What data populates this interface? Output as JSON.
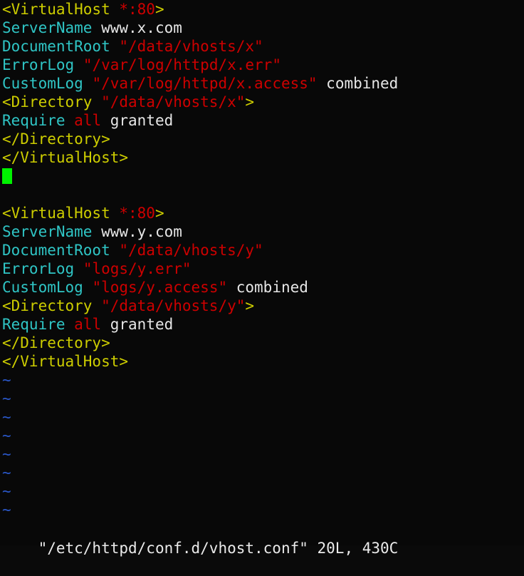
{
  "window": {
    "app": "vim",
    "background_color": "#080808",
    "cursor_color": "#00f200"
  },
  "palette": {
    "tag": "#cdcd00",
    "directive": "#2fc5c5",
    "string": "#cd0000",
    "plain": "#e6e6e6",
    "tilde": "#2a57c8",
    "status": "#eaeaea"
  },
  "editor": {
    "lines": [
      {
        "id": 1,
        "tokens": [
          {
            "t": "<VirtualHost ",
            "c": "tag"
          },
          {
            "t": "*:80",
            "c": "string"
          },
          {
            "t": ">",
            "c": "tag"
          }
        ]
      },
      {
        "id": 2,
        "tokens": [
          {
            "t": "ServerName",
            "c": "directive"
          },
          {
            "t": " www.x.com",
            "c": "plain"
          }
        ]
      },
      {
        "id": 3,
        "tokens": [
          {
            "t": "DocumentRoot",
            "c": "directive"
          },
          {
            "t": " ",
            "c": "plain"
          },
          {
            "t": "\"/data/vhosts/x\"",
            "c": "string"
          }
        ]
      },
      {
        "id": 4,
        "tokens": [
          {
            "t": "ErrorLog",
            "c": "directive"
          },
          {
            "t": " ",
            "c": "plain"
          },
          {
            "t": "\"/var/log/httpd/x.err\"",
            "c": "string"
          }
        ]
      },
      {
        "id": 5,
        "tokens": [
          {
            "t": "CustomLog",
            "c": "directive"
          },
          {
            "t": " ",
            "c": "plain"
          },
          {
            "t": "\"/var/log/httpd/x.access\"",
            "c": "string"
          },
          {
            "t": " combined",
            "c": "plain"
          }
        ]
      },
      {
        "id": 6,
        "tokens": [
          {
            "t": "<Directory ",
            "c": "tag"
          },
          {
            "t": "\"/data/vhosts/x\"",
            "c": "string"
          },
          {
            "t": ">",
            "c": "tag"
          }
        ]
      },
      {
        "id": 7,
        "tokens": [
          {
            "t": "Require",
            "c": "directive"
          },
          {
            "t": " ",
            "c": "plain"
          },
          {
            "t": "all",
            "c": "string"
          },
          {
            "t": " granted",
            "c": "plain"
          }
        ]
      },
      {
        "id": 8,
        "tokens": [
          {
            "t": "</Directory>",
            "c": "tag"
          }
        ]
      },
      {
        "id": 9,
        "tokens": [
          {
            "t": "</VirtualHost>",
            "c": "tag"
          }
        ]
      },
      {
        "id": 10,
        "tokens": [],
        "cursor": true
      },
      {
        "id": 11,
        "tokens": []
      },
      {
        "id": 12,
        "tokens": [
          {
            "t": "<VirtualHost ",
            "c": "tag"
          },
          {
            "t": "*:80",
            "c": "string"
          },
          {
            "t": ">",
            "c": "tag"
          }
        ]
      },
      {
        "id": 13,
        "tokens": [
          {
            "t": "ServerName",
            "c": "directive"
          },
          {
            "t": " www.y.com",
            "c": "plain"
          }
        ]
      },
      {
        "id": 14,
        "tokens": [
          {
            "t": "DocumentRoot",
            "c": "directive"
          },
          {
            "t": " ",
            "c": "plain"
          },
          {
            "t": "\"/data/vhosts/y\"",
            "c": "string"
          }
        ]
      },
      {
        "id": 15,
        "tokens": [
          {
            "t": "ErrorLog",
            "c": "directive"
          },
          {
            "t": " ",
            "c": "plain"
          },
          {
            "t": "\"logs/y.err\"",
            "c": "string"
          }
        ]
      },
      {
        "id": 16,
        "tokens": [
          {
            "t": "CustomLog",
            "c": "directive"
          },
          {
            "t": " ",
            "c": "plain"
          },
          {
            "t": "\"logs/y.access\"",
            "c": "string"
          },
          {
            "t": " combined",
            "c": "plain"
          }
        ]
      },
      {
        "id": 17,
        "tokens": [
          {
            "t": "<Directory ",
            "c": "tag"
          },
          {
            "t": "\"/data/vhosts/y\"",
            "c": "string"
          },
          {
            "t": ">",
            "c": "tag"
          }
        ]
      },
      {
        "id": 18,
        "tokens": [
          {
            "t": "Require",
            "c": "directive"
          },
          {
            "t": " ",
            "c": "plain"
          },
          {
            "t": "all",
            "c": "string"
          },
          {
            "t": " granted",
            "c": "plain"
          }
        ]
      },
      {
        "id": 19,
        "tokens": [
          {
            "t": "</Directory>",
            "c": "tag"
          }
        ]
      },
      {
        "id": 20,
        "tokens": [
          {
            "t": "</VirtualHost>",
            "c": "tag"
          }
        ]
      }
    ],
    "filler_marker": "~",
    "filler_count": 8
  },
  "status_line": {
    "filename": "\"/etc/httpd/conf.d/vhost.conf\"",
    "lines_count": "20L",
    "chars_count": "430C",
    "text": "\"/etc/httpd/conf.d/vhost.conf\" 20L, 430C"
  }
}
